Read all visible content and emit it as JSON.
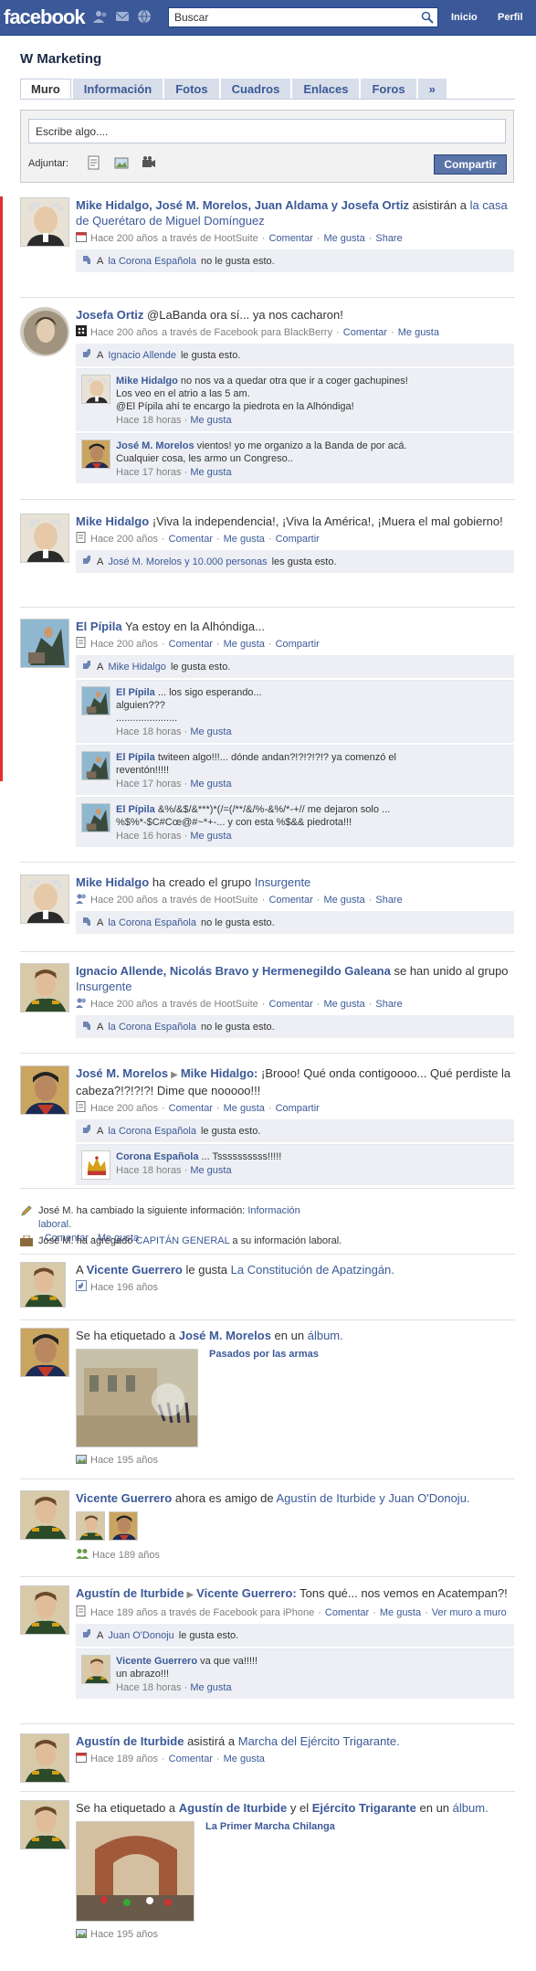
{
  "topbar": {
    "logo": "facebook",
    "search_placeholder": "Buscar",
    "search_value": "Buscar",
    "nav_inicio": "Inicio",
    "nav_perfil": "Perfil"
  },
  "page": {
    "title": "W Marketing"
  },
  "tabs": [
    "Muro",
    "Información",
    "Fotos",
    "Cuadros",
    "Enlaces",
    "Foros",
    "»"
  ],
  "composer": {
    "placeholder": "Escribe algo....",
    "adjuntar": "Adjuntar:",
    "button": "Compartir"
  },
  "colors": {
    "brand": "#3b5998",
    "link": "#3b5998",
    "likebox": "#edeff4"
  },
  "common": {
    "hace200": "Hace 200 años",
    "comentar": "Comentar",
    "megusta": "Me gusta",
    "share": "Share",
    "compartir": "Compartir",
    "via_hootsuite": "a través de HootSuite",
    "via_fb_bb": "a través de Facebook para BlackBerry",
    "corona": "la Corona Española",
    "no_gusta": "no le gusta esto.",
    "le_gusta": "le gusta esto.",
    "les_gusta": "les gusta esto."
  },
  "s1": {
    "names": "Mike Hidalgo, José M. Morelos, Juan Aldama y Josefa Ortiz",
    "text": "asistirán a",
    "event": "la casa de Querétaro de Miguel Domínguez",
    "time": "Hace 200 años",
    "a": "A"
  },
  "s2": {
    "name": "Josefa Ortiz",
    "text": "@LaBanda ora sí... ya nos cacharon!",
    "like_a": "A",
    "like_name": "Ignacio Allende",
    "c1": {
      "name": "Mike Hidalgo",
      "text1": "no nos va a quedar otra que ir a coger gachupines!",
      "text2": "Los veo en el atrio a las 5 am.",
      "text3": "@El Pípila ahí te encargo la piedrota en la Alhóndiga!",
      "time": "Hace 18 horas"
    },
    "c2": {
      "name": "José M. Morelos",
      "text1": "vientos! yo me organizo a la Banda de por acá.",
      "text2": "Cualquier cosa, les armo un Congreso..",
      "time": "Hace 17 horas"
    }
  },
  "s3": {
    "name": "Mike Hidalgo",
    "text": "¡Viva la independencia!, ¡Viva la América!, ¡Muera el mal gobierno!",
    "time": "Hace 200 años",
    "like_a": "A",
    "like_names": "José M. Morelos y 10.000 personas"
  },
  "s4": {
    "name": "El Pípila",
    "text": "Ya estoy en la Alhóndiga...",
    "time": "Hace 200 años",
    "like_a": "A",
    "like_name": "Mike Hidalgo",
    "c1": {
      "name": "El Pípila",
      "text1": "... los sigo esperando...",
      "text2": "alguien???",
      "text3": "......................",
      "time": "Hace 18 horas"
    },
    "c2": {
      "name": "El Pípila",
      "text1": "twiteen algo!!!... dónde andan?!?!?!?!? ya comenzó el",
      "text2": "reventón!!!!!",
      "time": "Hace 17 horas"
    },
    "c3": {
      "name": "El Pípila",
      "text1": "&%/&$/&***)*(/=(/**/&/%-&%/*-+// me dejaron solo ...",
      "text2": "%$%*-$C#Cœ@#~*+-... y con esta %$&& piedrota!!!",
      "time": "Hace 16 horas"
    }
  },
  "s5": {
    "name": "Mike Hidalgo",
    "text": "ha creado el grupo",
    "group": "Insurgente",
    "time": "Hace 200 años"
  },
  "s6": {
    "names": "Ignacio Allende, Nicolás Bravo y Hermenegildo Galeana",
    "text": "se han unido al grupo",
    "group": "Insurgente",
    "time": "Hace 200 años"
  },
  "s7": {
    "name": "José M. Morelos",
    "target": "Mike Hidalgo:",
    "text": "¡Brooo! Qué onda contigoooo... Qué perdiste la cabeza?!?!?!?! Dime que nooooo!!!",
    "time": "Hace 200 años",
    "c1": {
      "name": "Corona Española",
      "text": "... Tssssssssss!!!!!",
      "time": "Hace 18 horas"
    }
  },
  "m1": {
    "name": "José M.",
    "text": "ha cambiado la siguiente información:",
    "link": "Información laboral.",
    "comentar": "Comentar",
    "megusta": "Me gusta"
  },
  "m2": {
    "name": "José M.",
    "text": "ha agregado",
    "cargo": "CAPITÁN GENERAL",
    "rest": "a su información laboral."
  },
  "s8": {
    "a": "A",
    "name": "Vicente Guerrero",
    "text": "le gusta",
    "link": "La Constitución de Apatzingán.",
    "time": "Hace 196 años"
  },
  "s9": {
    "text": "Se ha etiquetado a",
    "name": "José M. Morelos",
    "text2": "en un",
    "album": "álbum.",
    "caption": "Pasados por las armas",
    "time": "Hace 195 años"
  },
  "s10": {
    "name": "Vicente Guerrero",
    "text": "ahora es amigo de",
    "friends": "Agustín de Iturbide y Juan O'Donoju.",
    "time": "Hace 189 años"
  },
  "s11": {
    "name": "Agustín de Iturbide",
    "target": "Vicente Guerrero:",
    "text": "Tons qué... nos vemos en Acatempan?!",
    "time": "Hace 189 años a través de Facebook para iPhone",
    "vermas": "Ver muro a muro",
    "like_a": "A",
    "like_name": "Juan O'Donoju",
    "c1": {
      "name": "Vicente Guerrero",
      "text1": "va que va!!!!!",
      "text2": "un abrazo!!!",
      "time": "Hace 18 horas"
    }
  },
  "s12": {
    "name": "Agustín de Iturbide",
    "text": "asistirá a",
    "event": "Marcha del Ejército Trigarante.",
    "time": "Hace 189 años"
  },
  "s13": {
    "text": "Se ha etiquetado a",
    "name1": "Agustín de Iturbide",
    "y": "y el",
    "name2": "Ejército Trigarante",
    "text2": "en un",
    "album": "álbum.",
    "caption": "La Primer Marcha Chilanga",
    "time": "Hace 195 años"
  }
}
